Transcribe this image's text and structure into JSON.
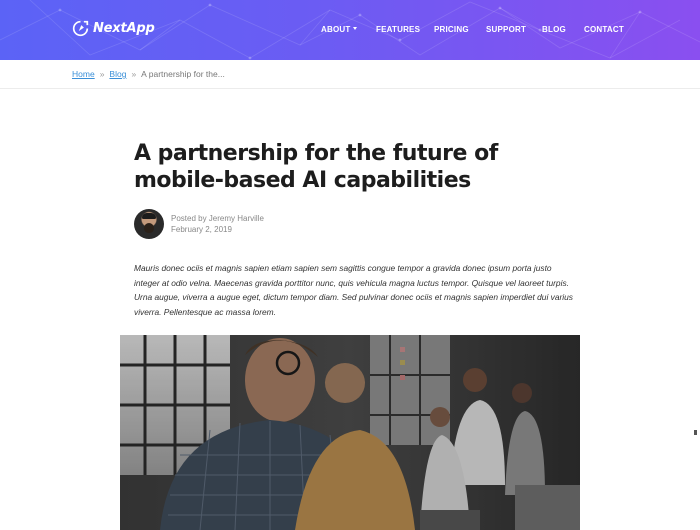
{
  "brand": {
    "name": "NextApp"
  },
  "nav": {
    "items": [
      {
        "label": "ABOUT",
        "has_dropdown": true
      },
      {
        "label": "FEATURES",
        "has_dropdown": false
      },
      {
        "label": "PRICING",
        "has_dropdown": false
      },
      {
        "label": "SUPPORT",
        "has_dropdown": false
      },
      {
        "label": "BLOG",
        "has_dropdown": false
      },
      {
        "label": "CONTACT",
        "has_dropdown": false
      }
    ]
  },
  "breadcrumb": {
    "home": "Home",
    "blog": "Blog",
    "separator": "»",
    "current": "A partnership for the..."
  },
  "article": {
    "title": "A partnership for the future of mobile-based AI capabilities",
    "byline": "Posted by Jeremy Harville",
    "date": "February 2, 2019",
    "lead": "Mauris donec ociis et magnis sapien etiam sapien sem sagittis congue tempor a gravida donec ipsum porta justo integer at odio velna. Maecenas gravida porttitor nunc, quis vehicula magna luctus tempor. Quisque vel laoreet turpis. Urna augue, viverra a augue eget, dictum tempor diam. Sed pulvinar donec ociis et magnis sapien imperdiet dui varius viverra. Pellentesque ac massa lorem."
  },
  "colors": {
    "header_gradient_start": "#5b63f6",
    "header_gradient_end": "#8a4ff0",
    "link": "#3a8fd8",
    "title": "#1d1d1d"
  },
  "icons": {
    "logo": "rocket-cycle-icon",
    "dropdown": "caret-down-icon"
  }
}
